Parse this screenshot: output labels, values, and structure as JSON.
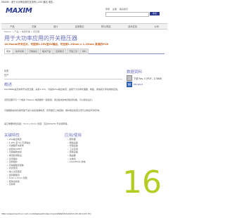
{
  "browser": {
    "tab_title": "MAXIM - 用于大功率应用的支持有1.25V 输出 电压..."
  },
  "header": {
    "logo_text": "MAXIM",
    "login_links": [
      "登录",
      "注册",
      "联系我们"
    ],
    "search_placeholder": "",
    "lang_label": "中文"
  },
  "nav": {
    "items": [
      "产品",
      "方案",
      "设计",
      "应用笔记",
      "样片/购买",
      "技术支持",
      "公司"
    ]
  },
  "breadcrumb": "Maxim > 产品 > 电源管理 > 稳压器",
  "page": {
    "title": "用于大功率应用的开关稳压器",
    "subtitle": "16 Maxim开关芯片，可提供1.25V至5V输出，可支持1.25mm x 1.25mm 紧凑的PCB",
    "tabs": [
      "概述",
      "技术文档",
      "订购信息",
      "相关产品",
      "应用笔记",
      "开发工具",
      "样片"
    ]
  },
  "left": {
    "status_label": "状态",
    "status_value": "在产",
    "overview_title": "概述",
    "paragraphs": [
      "MAX8686是高效率开关稳压器，采用1.25V，可提供25A输出电流，适用于大功率处理器、网络、通信和计算领域的应用。",
      "该稳压器可与一个或多个Maxim 电源器件一起使用，通过集成的电流检测功能，可以简化设计。",
      "可编程软启动功能有助于减少启动浪涌电流，实现顺序上电控制，保护输出免受过流与过热损坏的影响。",
      "其它重要特性包括：5mm x 5mm 封装、高达600kHz 开关频率等。"
    ],
    "key_features_title": "关键特性",
    "key_features": [
      "• 25A输出电流",
      "• 1.25V 至 5V 可调输出",
      "• 可编程开关频率",
      "• 内置MOSFET",
      "• 可编程软启动",
      "• 电流检测输出",
      "• 过流保护",
      "• 过热保护",
      "• 可编程顺序控制",
      "• 同步整流",
      "• 输入欠压锁定",
      "• 逐周期限流",
      "• 5mm x 5mm 封装",
      "• 低输出纹波",
      "• 高效率"
    ],
    "applications_title": "应用/使用",
    "applications": [
      "• 服务器",
      "• 网络设备",
      "• 存储设备",
      "• 工业应用",
      "• 通信设备",
      "• 路由器",
      "• 交换机",
      "• ASIC/FPGA 供电"
    ]
  },
  "right": {
    "doc_title": "数据资料",
    "doc_link": "下载 Rev. 0 (PDF，178KB)",
    "ms_link": "MS Word"
  },
  "badge_number": "16",
  "footer_url": "http://www.maxim-ic.com.cn/datasheet/index.mvp/id/6492/t/do[2013-05-09 4:07:37]"
}
